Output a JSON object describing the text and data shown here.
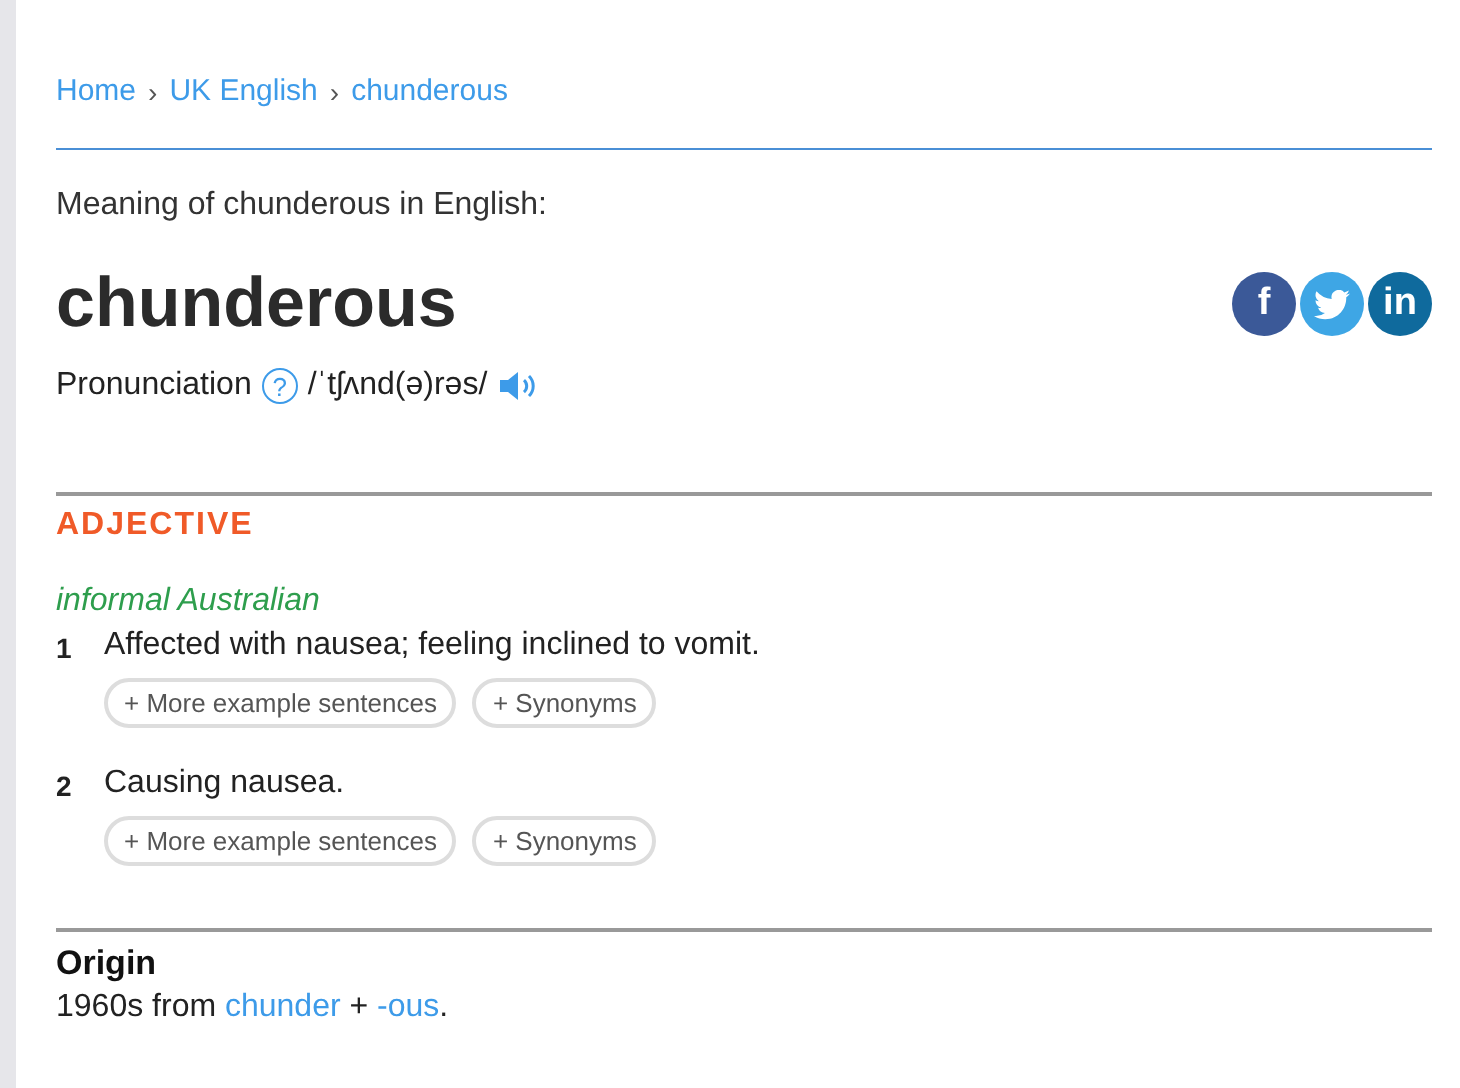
{
  "breadcrumbs": {
    "separator": "›",
    "items": [
      "Home",
      "UK English",
      "chunderous"
    ]
  },
  "intro": "Meaning of chunderous in English:",
  "headword": "chunderous",
  "share": [
    {
      "kind": "facebook",
      "label": "f"
    },
    {
      "kind": "twitter"
    },
    {
      "kind": "linkedin",
      "label": "in"
    }
  ],
  "pronunciation": {
    "label": "Pronunciation",
    "help": "?",
    "ipa": "/ˈtʃʌnd(ə)rəs/"
  },
  "part_of_speech": "ADJECTIVE",
  "register": "informal Australian",
  "senses": [
    {
      "number": "1",
      "definition": "Affected with nausea; feeling inclined to vomit.",
      "buttons": [
        "+ More example sentences",
        "+ Synonyms"
      ]
    },
    {
      "number": "2",
      "definition": "Causing nausea.",
      "buttons": [
        "+ More example sentences",
        "+ Synonyms"
      ]
    }
  ],
  "origin": {
    "title": "Origin",
    "parts": [
      {
        "kind": "text",
        "text": "1960s from "
      },
      {
        "kind": "link",
        "text": "chunder"
      },
      {
        "kind": "text",
        "text": " + "
      },
      {
        "kind": "link",
        "text": "-ous"
      },
      {
        "kind": "text",
        "text": "."
      }
    ]
  }
}
